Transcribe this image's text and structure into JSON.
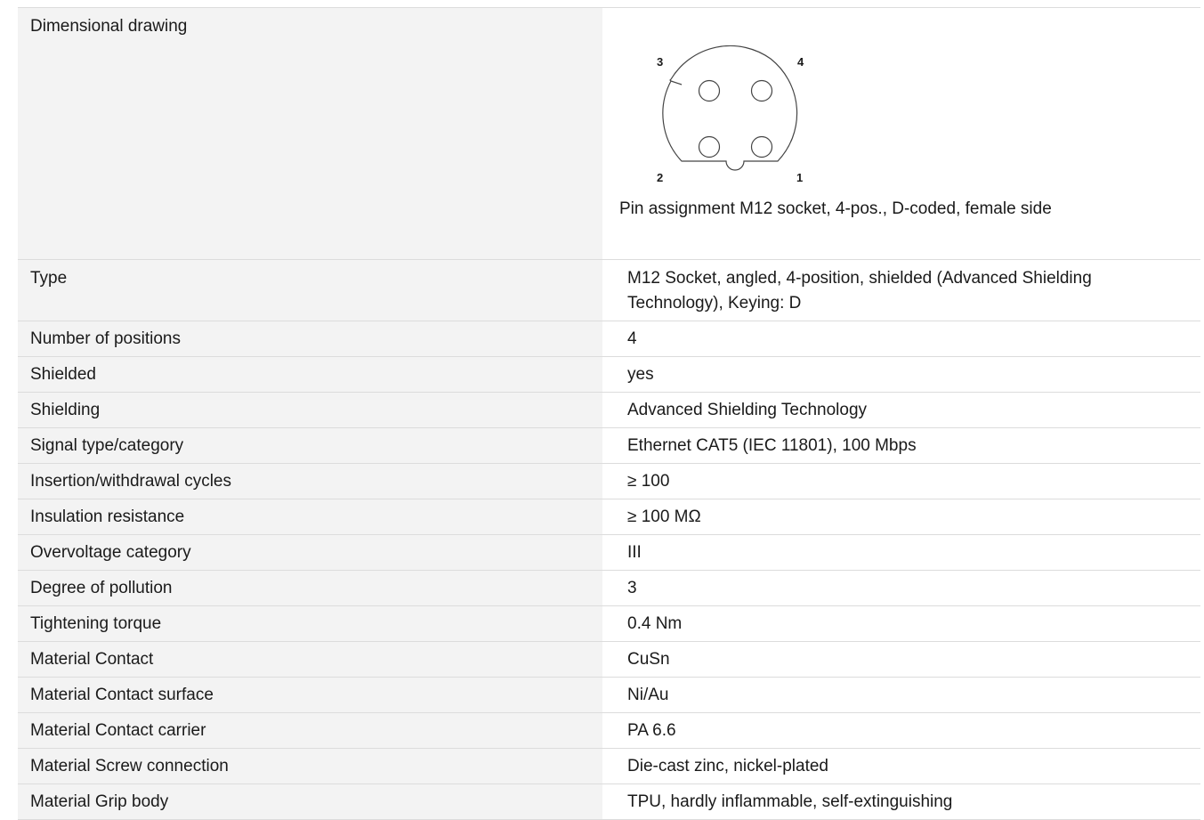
{
  "drawing": {
    "label": "Dimensional drawing",
    "pin_labels": [
      "3",
      "4",
      "2",
      "1"
    ],
    "caption": "Pin assignment M12 socket, 4-pos., D-coded, female side"
  },
  "rows": [
    {
      "label": "Type",
      "value": "M12 Socket, angled, 4-position, shielded (Advanced Shielding Technology), Keying: D"
    },
    {
      "label": "Number of positions",
      "value": "4"
    },
    {
      "label": "Shielded",
      "value": "yes"
    },
    {
      "label": "Shielding",
      "value": "Advanced Shielding Technology"
    },
    {
      "label": "Signal type/category",
      "value": "Ethernet CAT5 (IEC 11801), 100 Mbps"
    },
    {
      "label": "Insertion/withdrawal cycles",
      "value": "≥ 100"
    },
    {
      "label": "Insulation resistance",
      "value": "≥ 100 MΩ"
    },
    {
      "label": "Overvoltage category",
      "value": "III"
    },
    {
      "label": "Degree of pollution",
      "value": "3"
    },
    {
      "label": "Tightening torque",
      "value": "0.4 Nm"
    },
    {
      "label": "Material Contact",
      "value": "CuSn"
    },
    {
      "label": "Material Contact surface",
      "value": "Ni/Au"
    },
    {
      "label": "Material Contact carrier",
      "value": "PA 6.6"
    },
    {
      "label": "Material Screw connection",
      "value": "Die-cast zinc, nickel-plated"
    },
    {
      "label": "Material Grip body",
      "value": "TPU, hardly inflammable, self-extinguishing"
    }
  ]
}
